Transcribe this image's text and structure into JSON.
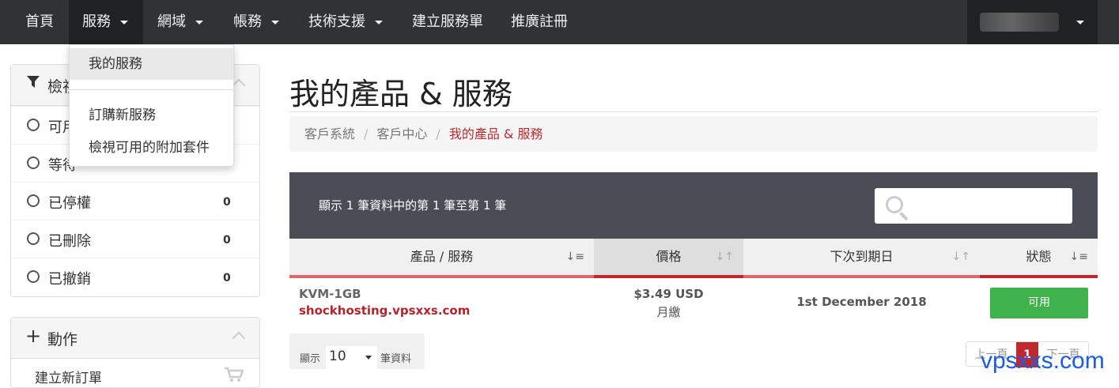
{
  "nav": {
    "items": [
      "首頁",
      "服務",
      "網域",
      "帳務",
      "技術支援",
      "建立服務單",
      "推廣註冊"
    ],
    "dropdown": [
      "我的服務",
      "訂購新服務",
      "檢視可用的附加套件"
    ]
  },
  "sidebar": {
    "filter_title": "檢視",
    "filters": [
      {
        "label": "可用",
        "count": ""
      },
      {
        "label": "等待",
        "count": ""
      },
      {
        "label": "已停權",
        "count": "0"
      },
      {
        "label": "已刪除",
        "count": "0"
      },
      {
        "label": "已撤銷",
        "count": "0"
      }
    ],
    "actions_title": "動作",
    "actions": [
      "建立新訂單"
    ]
  },
  "main": {
    "title": "我的產品 & 服務",
    "breadcrumb": [
      "客戶系統",
      "客戶中心",
      "我的產品 & 服務"
    ],
    "table_info": "顯示 1 筆資料中的第 1 筆至第 1 筆",
    "columns": [
      "產品 / 服務",
      "價格",
      "下次到期日",
      "狀態"
    ],
    "rows": [
      {
        "product": "KVM-1GB",
        "domain": "shockhosting.vpsxxs.com",
        "price": "$3.49 USD",
        "cycle": "月繳",
        "due": "1st December 2018",
        "status": "可用"
      }
    ],
    "length": {
      "prefix": "顯示",
      "value": "10",
      "suffix": "筆資料"
    },
    "pager": {
      "prev": "上一頁",
      "current": "1",
      "next": "下一頁"
    }
  },
  "watermark": "vpsxxs.com",
  "colors": {
    "accent": "#c0282d",
    "status_active": "#3fb24b",
    "nav_bg": "#2f3334"
  }
}
